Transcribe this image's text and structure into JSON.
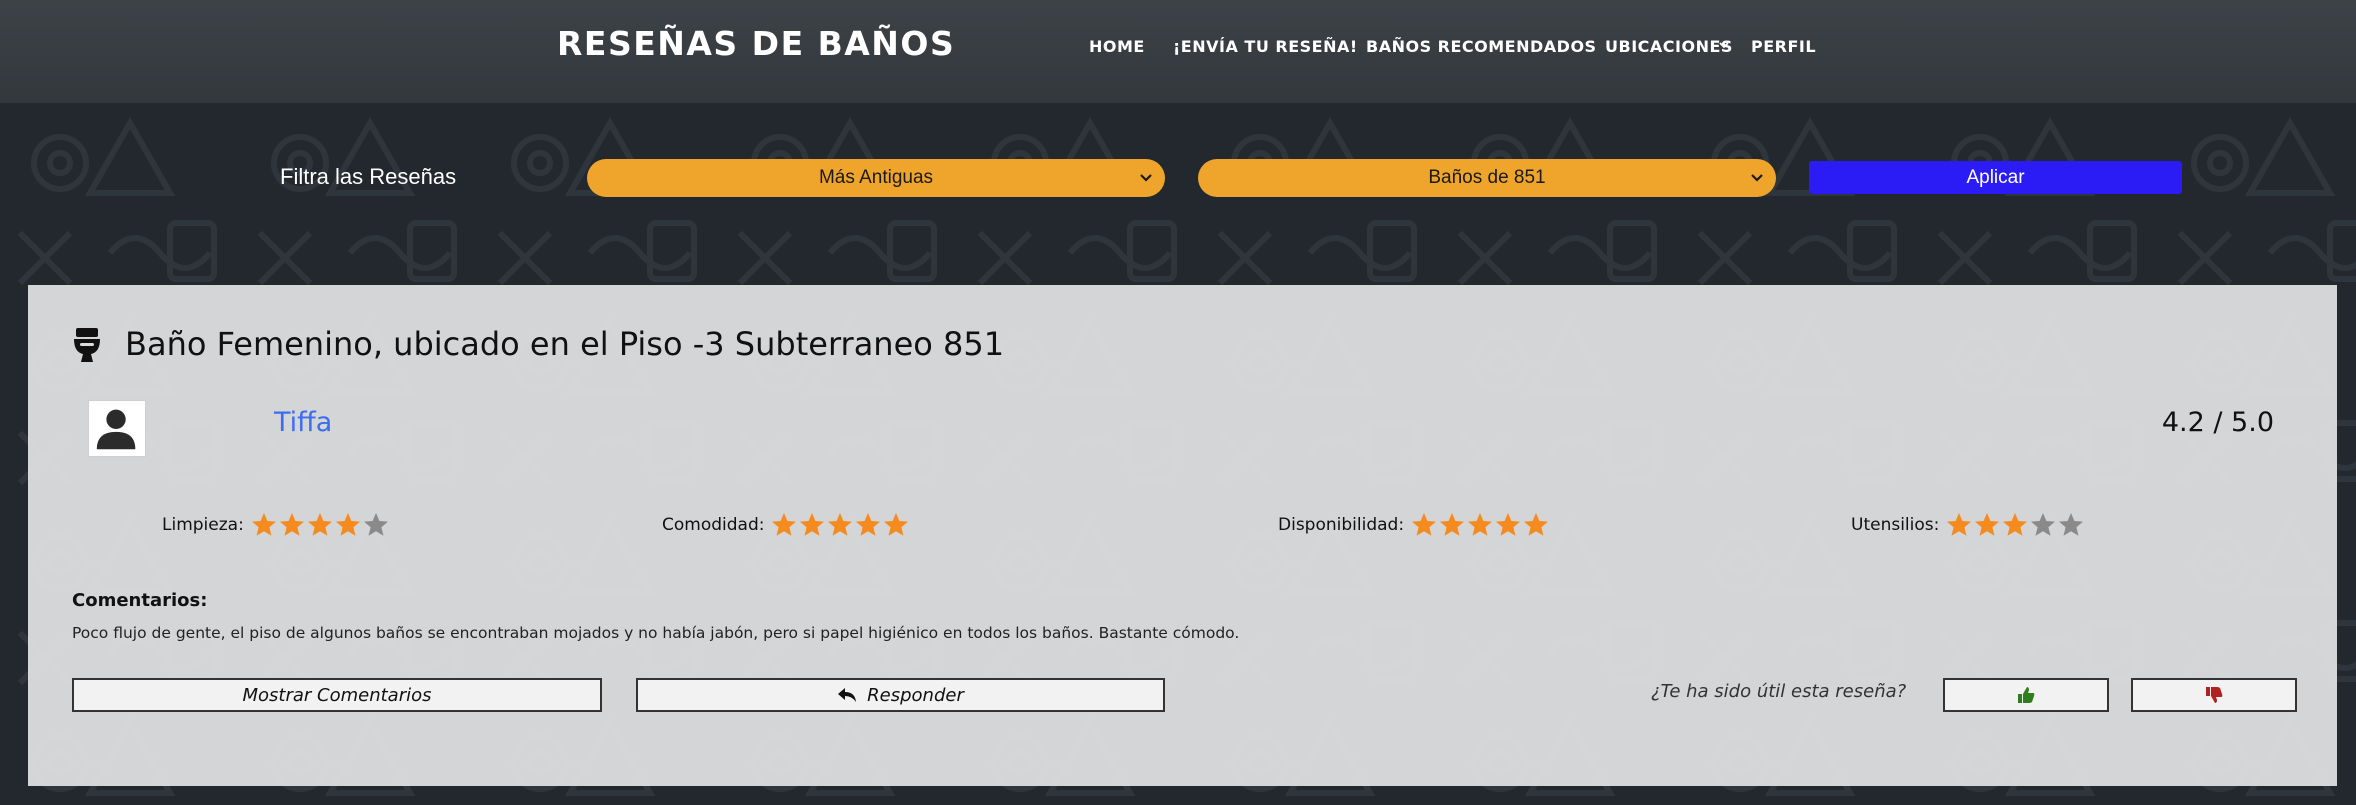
{
  "site": {
    "brand": "RESEÑAS DE BAÑOS"
  },
  "nav": {
    "home": "HOME",
    "submit_review": "¡ENVÍA TU RESEÑA!",
    "recommended": "BAÑOS RECOMENDADOS",
    "locations": "UBICACIONES",
    "profile": "PERFIL"
  },
  "filters": {
    "label": "Filtra las Reseñas",
    "order_selected": "Más Antiguas",
    "building_selected": "Baños de 851",
    "apply_label": "Aplicar"
  },
  "review": {
    "title": "Baño Femenino, ubicado en el Piso -3 Subterraneo 851",
    "user": "Tiffa",
    "score": "4.2 / 5.0",
    "ratings": [
      {
        "label": "Limpieza:",
        "value": 4,
        "max": 5
      },
      {
        "label": "Comodidad:",
        "value": 5,
        "max": 5
      },
      {
        "label": "Disponibilidad:",
        "value": 5,
        "max": 5
      },
      {
        "label": "Utensilios:",
        "value": 3,
        "max": 5
      }
    ],
    "comments_heading": "Comentarios:",
    "comments_text": "Poco flujo de gente, el piso de algunos baños se encontraban mojados y no había jabón, pero si papel higiénico en todos los baños. Bastante cómodo.",
    "show_comments_label": "Mostrar Comentarios",
    "reply_label": "Responder",
    "helpful_question": "¿Te ha sido útil esta reseña?"
  },
  "icons": {
    "toilet": "toilet-icon",
    "avatar": "user-avatar-icon",
    "reply": "reply-arrow-icon",
    "thumbs_up": "thumbs-up-icon",
    "thumbs_down": "thumbs-down-icon"
  },
  "colors": {
    "navbar": "#3a3f44",
    "page_background": "#23282e",
    "select_background": "#efa52c",
    "apply_button": "#2b1cf5",
    "username": "#3b6cf2",
    "star_filled": "#f58a1f",
    "star_empty": "#8a8a8a",
    "thumbs_up": "#2e7d1e",
    "thumbs_down": "#b32020"
  }
}
